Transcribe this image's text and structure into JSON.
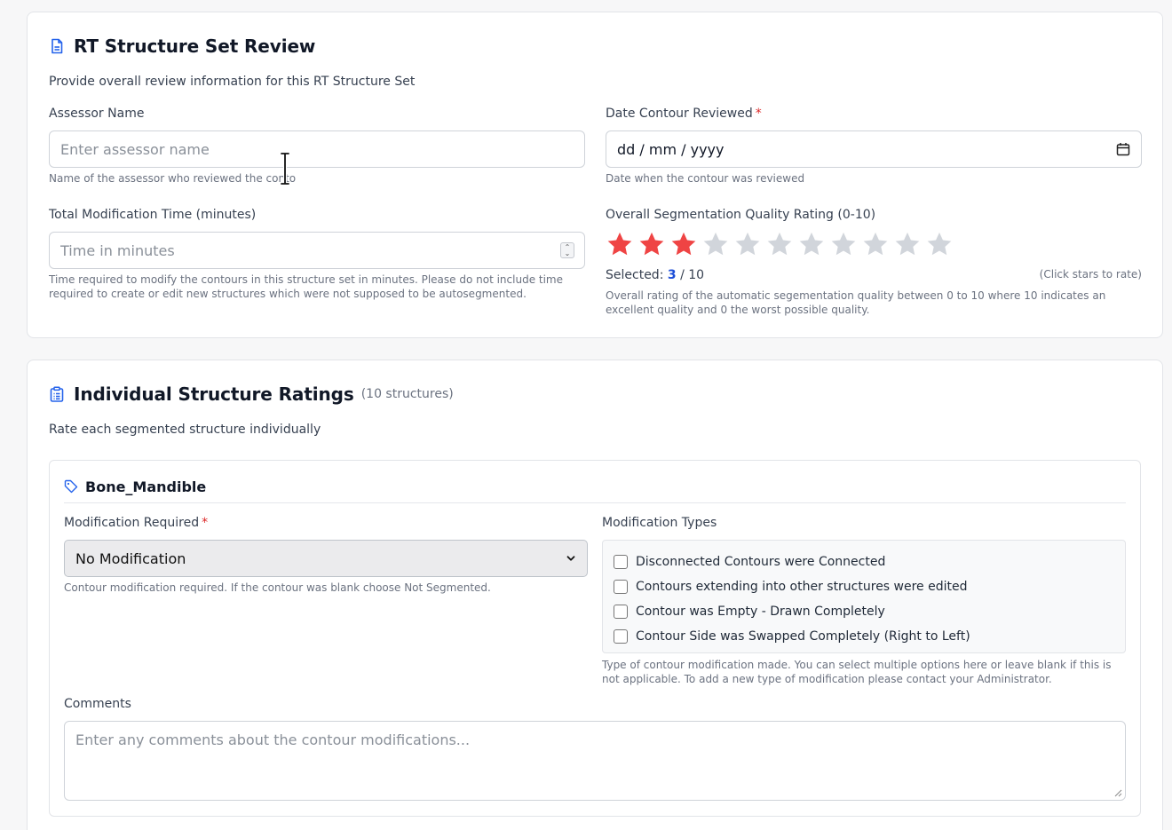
{
  "review": {
    "title": "RT Structure Set Review",
    "subtitle": "Provide overall review information for this RT Structure Set",
    "assessor": {
      "label": "Assessor Name",
      "placeholder": "Enter assessor name",
      "help": "Name of the assessor who reviewed the conto"
    },
    "date": {
      "label": "Date Contour Reviewed",
      "required_mark": "*",
      "value": "dd / mm / yyyy",
      "help": "Date when the contour was reviewed"
    },
    "time": {
      "label": "Total Modification Time (minutes)",
      "placeholder": "Time in minutes",
      "help": "Time required to modify the contours in this structure set in minutes. Please do not include time required to create or edit new structures which were not supposed to be autosegmented."
    },
    "rating": {
      "label": "Overall Segmentation Quality Rating (0-10)",
      "selected_prefix": "Selected:",
      "selected_value": "3",
      "selected_suffix": "/ 10",
      "hint": "(Click stars to rate)",
      "help": "Overall rating of the automatic segementation quality between 0 to 10 where 10 indicates an excellent quality and 0 the worst possible quality.",
      "value": 3,
      "max": 11,
      "active_color": "#ef4444",
      "inactive_color": "#d1d5db"
    }
  },
  "structures": {
    "title": "Individual Structure Ratings",
    "count": "(10 structures)",
    "subtitle": "Rate each segmented structure individually",
    "item": {
      "name": "Bone_Mandible",
      "modification": {
        "label": "Modification Required",
        "required_mark": "*",
        "value": "No Modification",
        "help": "Contour modification required. If the contour was blank choose Not Segmented."
      },
      "types": {
        "label": "Modification Types",
        "options": [
          "Disconnected Contours were Connected",
          "Contours extending into other structures were edited",
          "Contour was Empty - Drawn Completely",
          "Contour Side was Swapped Completely (Right to Left)"
        ],
        "help": "Type of contour modification made. You can select multiple options here or leave blank if this is not applicable. To add a new type of modification please contact your Administrator."
      },
      "comments": {
        "label": "Comments",
        "placeholder": "Enter any comments about the contour modifications..."
      }
    }
  },
  "colors": {
    "accent": "#2563eb",
    "required": "#dc2626"
  }
}
